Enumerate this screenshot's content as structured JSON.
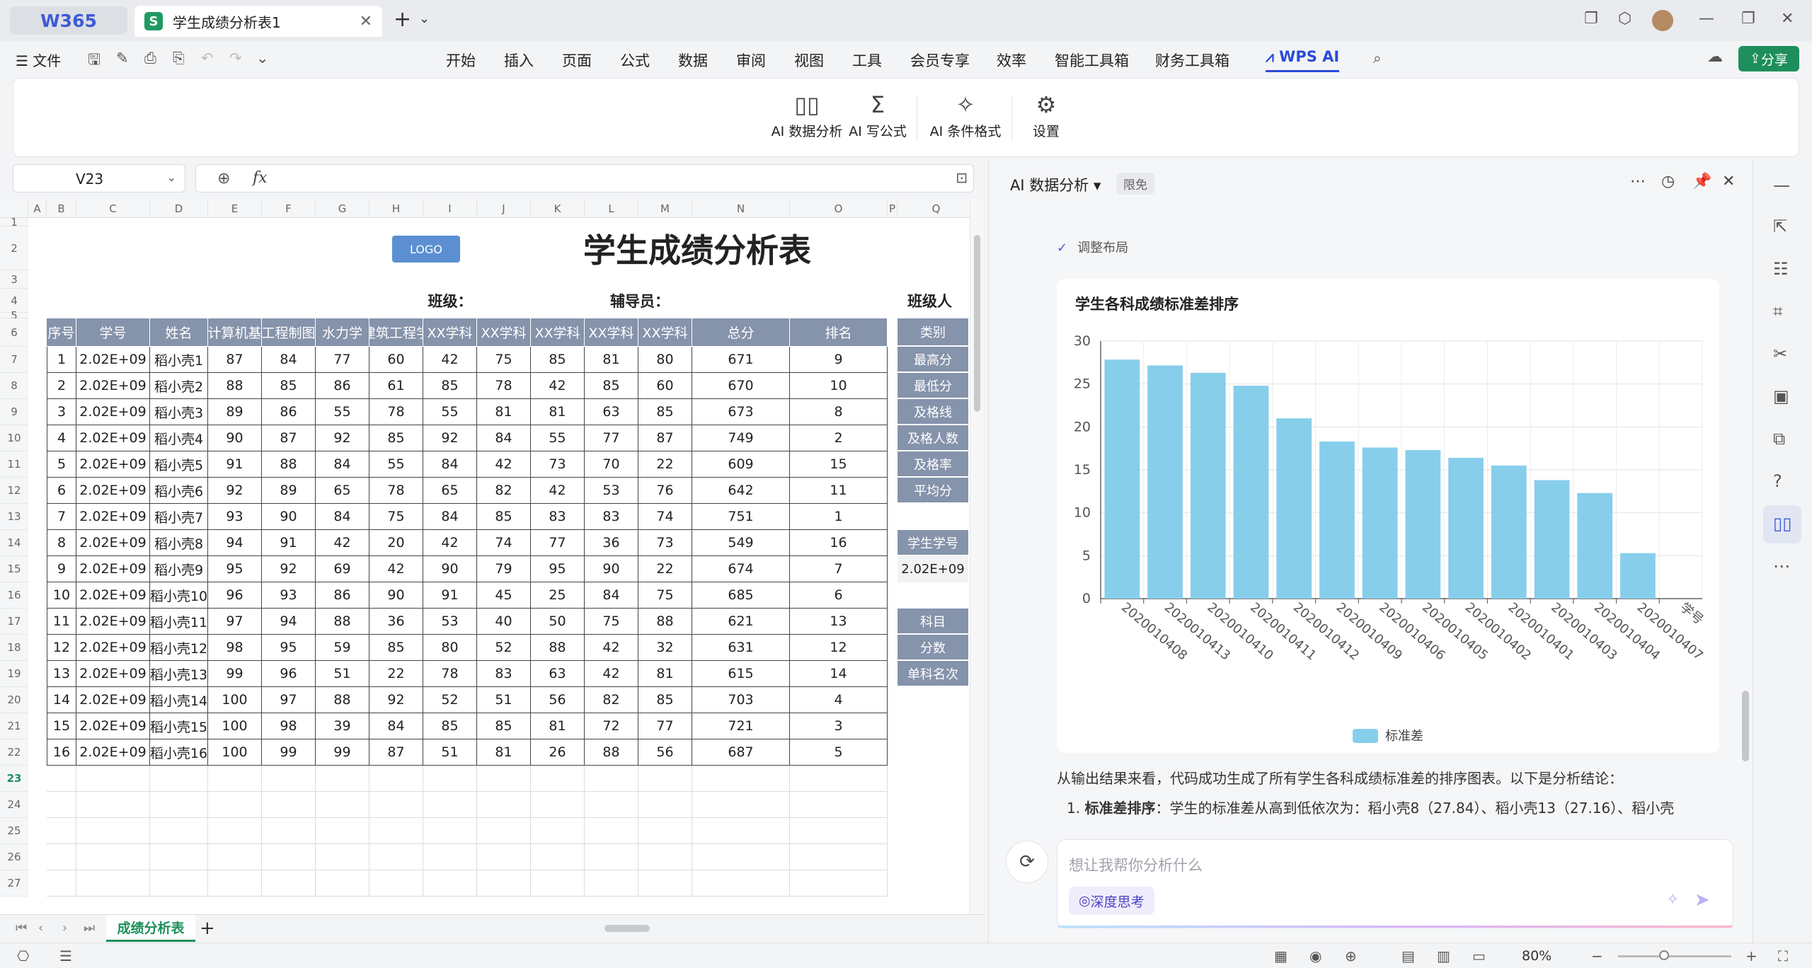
{
  "titlebar": {
    "home_label": "W365",
    "tab_icon": "S",
    "tab_title": "学生成绩分析表1",
    "avatar_label": ""
  },
  "menubar": {
    "file_label": "文件",
    "items": [
      "开始",
      "插入",
      "页面",
      "公式",
      "数据",
      "审阅",
      "视图",
      "工具",
      "会员专享",
      "效率",
      "智能工具箱",
      "财务工具箱"
    ],
    "active_label": "WPS AI",
    "share_label": "分享"
  },
  "ribbon": {
    "buttons": [
      "AI 数据分析",
      "AI 写公式",
      "AI 条件格式",
      "设置"
    ]
  },
  "formula": {
    "cell_ref": "V23",
    "fx_label": "fx",
    "value": ""
  },
  "sheet": {
    "columns": [
      "A",
      "B",
      "C",
      "D",
      "E",
      "F",
      "G",
      "H",
      "I",
      "J",
      "K",
      "L",
      "M",
      "N",
      "O",
      "P",
      "Q"
    ],
    "rows": [
      "1",
      "2",
      "3",
      "4",
      "5",
      "6",
      "7",
      "8",
      "9",
      "10",
      "11",
      "12",
      "13",
      "14",
      "15",
      "16",
      "17",
      "18",
      "19",
      "20",
      "21",
      "22",
      "23",
      "24",
      "25",
      "26",
      "27"
    ],
    "logo_text": "LOGO",
    "title": "学生成绩分析表",
    "class_label": "班级：",
    "tutor_label": "辅导员：",
    "class_trunc": "班级人",
    "table_headers": [
      "序号",
      "学号",
      "姓名",
      "计算机基",
      "工程制图",
      "水力学",
      "建筑工程学",
      "XX学科",
      "XX学科",
      "XX学科",
      "XX学科",
      "XX学科",
      "总分",
      "排名"
    ],
    "table_rows": [
      [
        "1",
        "2.02E+09",
        "稻小壳1",
        "87",
        "84",
        "77",
        "60",
        "42",
        "75",
        "85",
        "81",
        "80",
        "671",
        "9"
      ],
      [
        "2",
        "2.02E+09",
        "稻小壳2",
        "88",
        "85",
        "86",
        "61",
        "85",
        "78",
        "42",
        "85",
        "60",
        "670",
        "10"
      ],
      [
        "3",
        "2.02E+09",
        "稻小壳3",
        "89",
        "86",
        "55",
        "78",
        "55",
        "81",
        "81",
        "63",
        "85",
        "673",
        "8"
      ],
      [
        "4",
        "2.02E+09",
        "稻小壳4",
        "90",
        "87",
        "92",
        "85",
        "92",
        "84",
        "55",
        "77",
        "87",
        "749",
        "2"
      ],
      [
        "5",
        "2.02E+09",
        "稻小壳5",
        "91",
        "88",
        "84",
        "55",
        "84",
        "42",
        "73",
        "70",
        "22",
        "609",
        "15"
      ],
      [
        "6",
        "2.02E+09",
        "稻小壳6",
        "92",
        "89",
        "65",
        "78",
        "65",
        "82",
        "42",
        "53",
        "76",
        "642",
        "11"
      ],
      [
        "7",
        "2.02E+09",
        "稻小壳7",
        "93",
        "90",
        "84",
        "75",
        "84",
        "85",
        "83",
        "83",
        "74",
        "751",
        "1"
      ],
      [
        "8",
        "2.02E+09",
        "稻小壳8",
        "94",
        "91",
        "42",
        "20",
        "42",
        "74",
        "77",
        "36",
        "73",
        "549",
        "16"
      ],
      [
        "9",
        "2.02E+09",
        "稻小壳9",
        "95",
        "92",
        "69",
        "42",
        "90",
        "79",
        "95",
        "90",
        "22",
        "674",
        "7"
      ],
      [
        "10",
        "2.02E+09",
        "稻小壳10",
        "96",
        "93",
        "86",
        "90",
        "91",
        "45",
        "25",
        "84",
        "75",
        "685",
        "6"
      ],
      [
        "11",
        "2.02E+09",
        "稻小壳11",
        "97",
        "94",
        "88",
        "36",
        "53",
        "40",
        "50",
        "75",
        "88",
        "621",
        "13"
      ],
      [
        "12",
        "2.02E+09",
        "稻小壳12",
        "98",
        "95",
        "59",
        "85",
        "80",
        "52",
        "88",
        "42",
        "32",
        "631",
        "12"
      ],
      [
        "13",
        "2.02E+09",
        "稻小壳13",
        "99",
        "96",
        "51",
        "22",
        "78",
        "83",
        "63",
        "42",
        "81",
        "615",
        "14"
      ],
      [
        "14",
        "2.02E+09",
        "稻小壳14",
        "100",
        "97",
        "88",
        "92",
        "52",
        "51",
        "56",
        "82",
        "85",
        "703",
        "4"
      ],
      [
        "15",
        "2.02E+09",
        "稻小壳15",
        "100",
        "98",
        "39",
        "84",
        "85",
        "85",
        "81",
        "72",
        "77",
        "721",
        "3"
      ],
      [
        "16",
        "2.02E+09",
        "稻小壳16",
        "100",
        "99",
        "99",
        "87",
        "51",
        "81",
        "26",
        "88",
        "56",
        "687",
        "5"
      ]
    ],
    "stats_labels": [
      "类别",
      "最高分",
      "最低分",
      "及格线",
      "及格人数",
      "及格率",
      "平均分"
    ],
    "lookup_label": "学生学号",
    "lookup_value": "2.02E+09",
    "subject_labels": [
      "科目",
      "分数",
      "单科名次"
    ],
    "tab_name": "成绩分析表"
  },
  "status": {
    "zoom": "80%"
  },
  "ai_panel": {
    "title": "AI 数据分析",
    "badge": "限免",
    "step_label": "调整布局",
    "paragraph": "从输出结果来看，代码成功生成了所有学生各科成绩标准差的排序图表。以下是分析结论：",
    "list_item_bold": "标准差排序",
    "list_item_text": "：学生的标准差从高到低依次为：稻小壳8（27.84）、稻小壳13（27.16）、稻小壳",
    "list_item_num": "1.",
    "input_placeholder": "想让我帮你分析什么",
    "deep_think_label": "深度思考"
  },
  "chart_data": {
    "type": "bar",
    "title": "学生各科成绩标准差排序",
    "categories": [
      "2020010408",
      "2020010413",
      "2020010410",
      "2020010411",
      "2020010412",
      "2020010409",
      "2020010406",
      "2020010405",
      "2020010402",
      "2020010401",
      "2020010403",
      "2020010404",
      "2020010407",
      "学号"
    ],
    "series": [
      {
        "name": "标准差",
        "values": [
          27.84,
          27.16,
          26.3,
          24.8,
          21.0,
          18.3,
          17.6,
          17.3,
          16.4,
          15.5,
          13.8,
          12.3,
          5.3,
          0
        ]
      }
    ],
    "ylim": [
      0,
      30
    ],
    "yticks": [
      "0",
      "5",
      "10",
      "15",
      "20",
      "25",
      "30"
    ],
    "grid": true,
    "legend": "bottom",
    "bar_color": "#87ceeb"
  }
}
